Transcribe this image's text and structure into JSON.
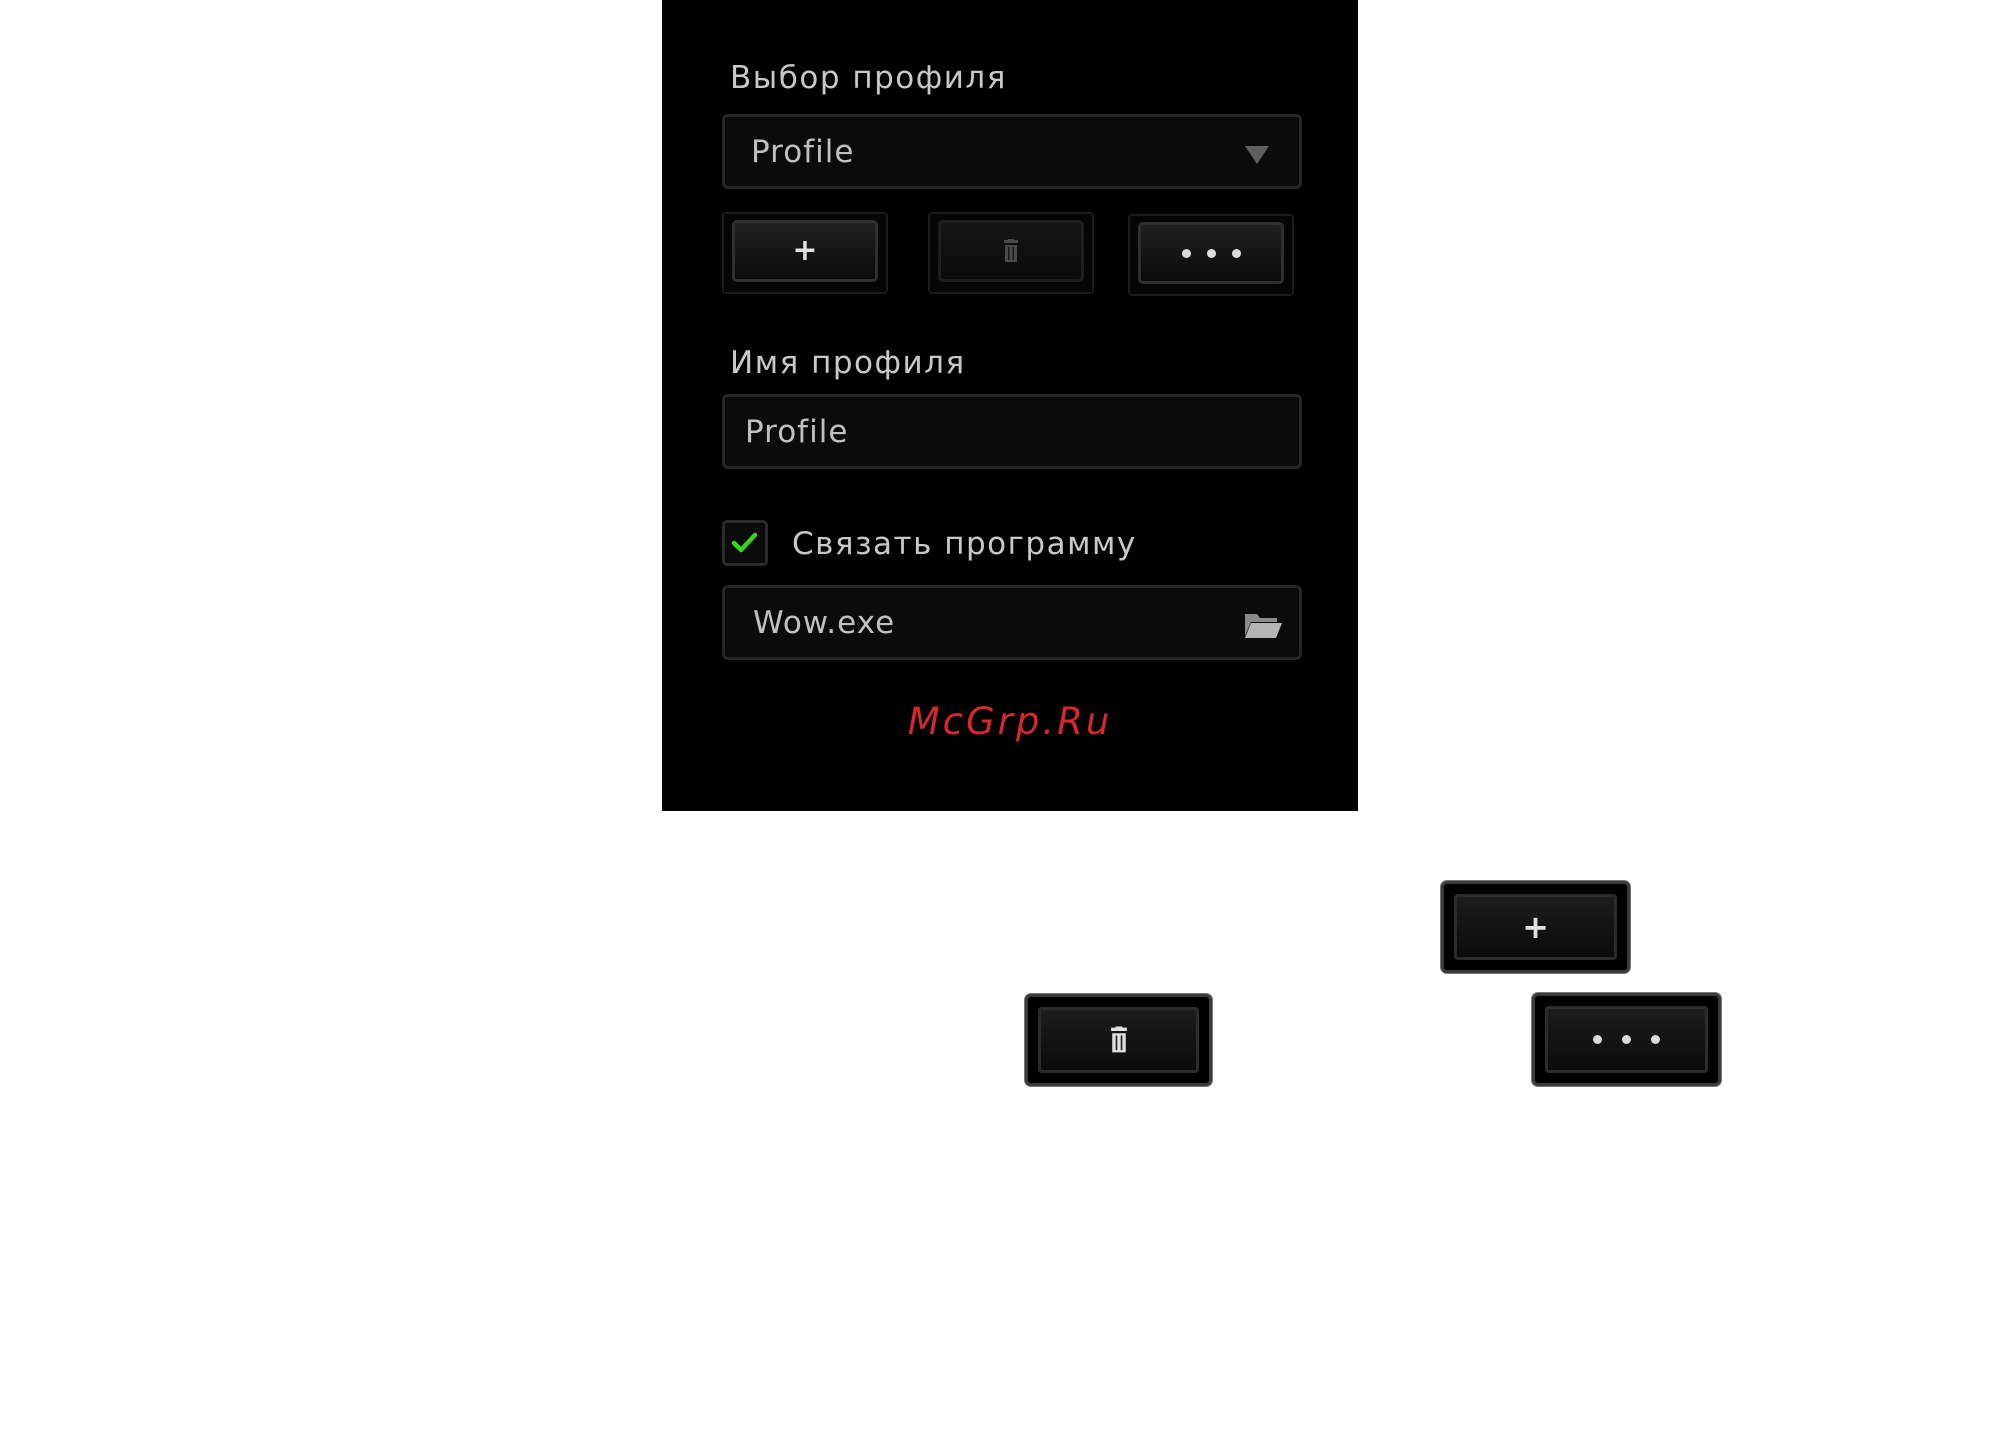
{
  "panel": {
    "profile_select_label": "Выбор профиля",
    "profile_dropdown_value": "Profile",
    "profile_name_label": "Имя профиля",
    "profile_name_value": "Profile",
    "link_program_label": "Связать программу",
    "link_program_checked": true,
    "program_value": "Wow.exe",
    "watermark": "McGrp.Ru"
  },
  "buttons": {
    "add_glyph": "+",
    "delete_icon": "trash-icon",
    "more_icon": "ellipsis-icon"
  },
  "colors": {
    "panel_bg": "#000000",
    "check_green": "#3ad41a",
    "watermark_red": "#d5282d"
  }
}
